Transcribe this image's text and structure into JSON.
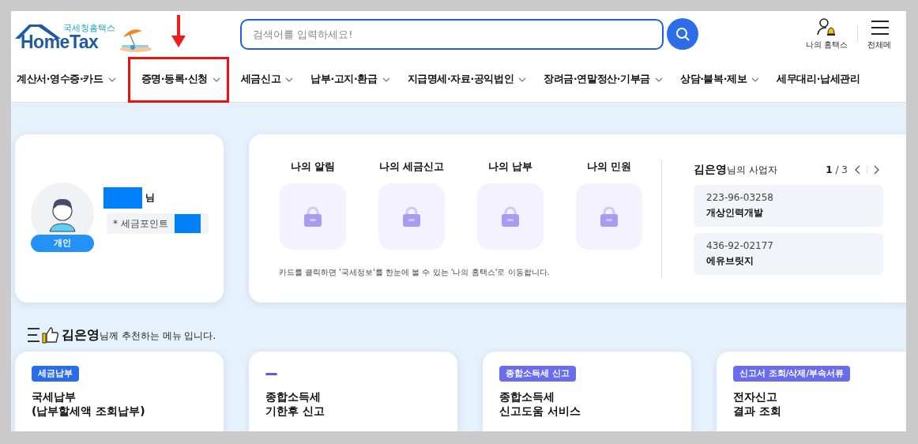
{
  "logo": {
    "subtitle": "국세청홈택스",
    "title": "HomeTax"
  },
  "search": {
    "placeholder": "검색어를 입력하세요!"
  },
  "header_links": [
    {
      "label": "나의 홈택스",
      "kind": "user"
    },
    {
      "label": "전체메",
      "kind": "menu"
    }
  ],
  "nav": [
    {
      "label": "계산서·영수증·카드",
      "caret": true,
      "highlighted": false
    },
    {
      "label": "증명·등록·신청",
      "caret": true,
      "highlighted": true
    },
    {
      "label": "세금신고",
      "caret": true,
      "highlighted": false
    },
    {
      "label": "납부·고지·환급",
      "caret": true,
      "highlighted": false
    },
    {
      "label": "지급명세·자료·공익법인",
      "caret": true,
      "highlighted": false
    },
    {
      "label": "장려금·연말정산·기부금",
      "caret": true,
      "highlighted": false
    },
    {
      "label": "상담·불복·제보",
      "caret": true,
      "highlighted": false
    },
    {
      "label": "세무대리·납세관리",
      "caret": false,
      "highlighted": false
    }
  ],
  "profile": {
    "suffix": "님",
    "points_label": "* 세금포인트",
    "badge": "개인"
  },
  "my_cards": [
    {
      "label": "나의 알림",
      "locked": true
    },
    {
      "label": "나의 세금신고",
      "locked": true
    },
    {
      "label": "나의 납부",
      "locked": true
    },
    {
      "label": "나의 민원",
      "locked": true
    }
  ],
  "notice": "카드를 클릭하면 '국세정보'를 한눈에 볼 수 있는 '나의 홈택스'로 이동합니다.",
  "businesses": {
    "owner": "김은영",
    "title_suffix": "님의 사업자",
    "page": "1",
    "total": "/ 3",
    "items": [
      {
        "number": "223-96-03258",
        "name": "개상인력개발"
      },
      {
        "number": "436-92-02177",
        "name": "에유브릿지"
      }
    ]
  },
  "recommend": {
    "name": "김은영",
    "text": "님께 추천하는 메뉴 입니다.",
    "cards": [
      {
        "kind": "tag",
        "tag": "세금납부",
        "color": "#2b6de6",
        "title_lines": [
          "국세납부",
          "(납부할세액 조회납부)"
        ]
      },
      {
        "kind": "dash",
        "color": "#5b5ce8",
        "title_lines": [
          "종합소득세",
          "기한후 신고"
        ]
      },
      {
        "kind": "tag",
        "tag": "종합소득세 신고",
        "color": "#6a6cee",
        "title_lines": [
          "종합소득세",
          "신고도움 서비스"
        ]
      },
      {
        "kind": "tag",
        "tag": "신고서 조회/삭제/부속서류",
        "color": "#6a6cee",
        "title_lines": [
          "전자신고",
          "결과 조회"
        ]
      }
    ]
  }
}
